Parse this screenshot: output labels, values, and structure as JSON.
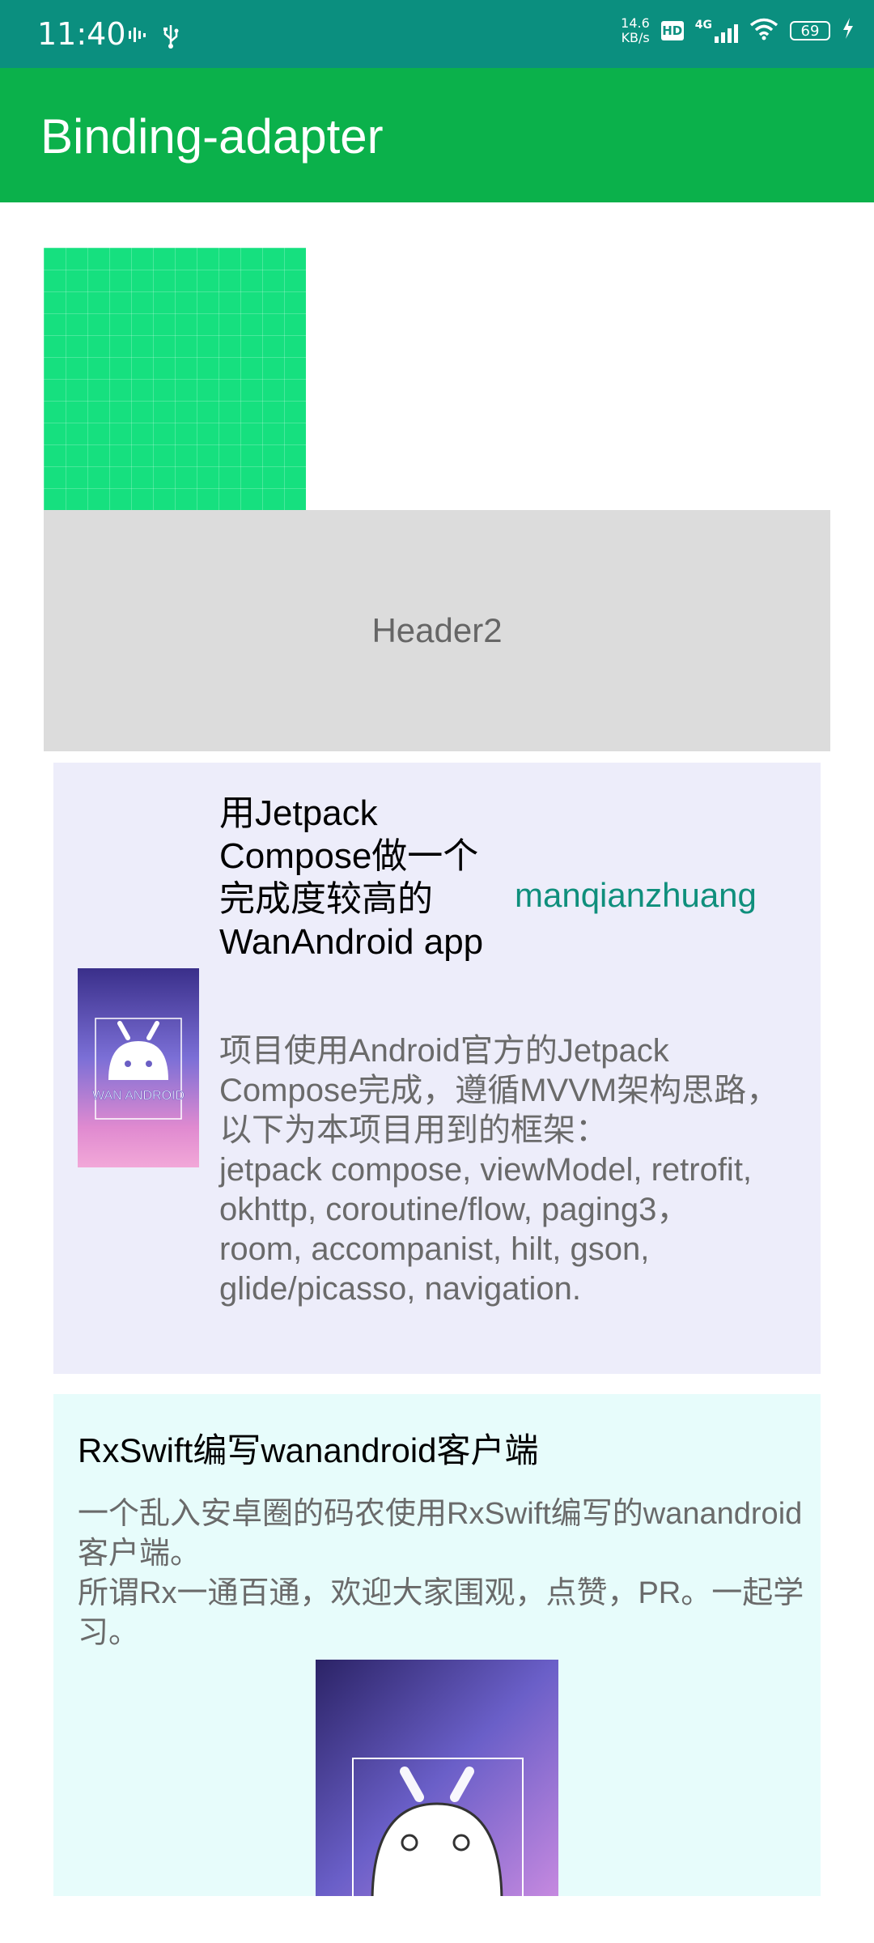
{
  "status_bar": {
    "time": "11:40",
    "net_speed_value": "14.6",
    "net_speed_unit": "KB/s",
    "hd_label": "HD",
    "network_label": "4G",
    "battery": "69"
  },
  "app_bar": {
    "title": "Binding-adapter",
    "color": "#0bb14b"
  },
  "header2": {
    "label": "Header2"
  },
  "project_card": {
    "title": "用Jetpack Compose做一个完成度较高的WanAndroid app",
    "author": "manqianzhuang",
    "description": "项目使用Android官方的Jetpack Compose完成，遵循MVVM架构思路，以下为本项目用到的框架：\njetpack compose, viewModel, retrofit, okhttp, coroutine/flow, paging3，\nroom, accompanist, hilt, gson, glide/picasso, navigation.",
    "thumbnail_text": "WAN ANDROID",
    "background": "#ededfa",
    "author_color": "#0f8f7c"
  },
  "article_card": {
    "title": "RxSwift编写wanandroid客户端",
    "description": "一个乱入安卓圈的码农使用RxSwift编写的wanandroid客户端。\n所谓Rx一通百通，欢迎大家围观，点赞，PR。一起学习。",
    "background": "#e7fcfb"
  }
}
